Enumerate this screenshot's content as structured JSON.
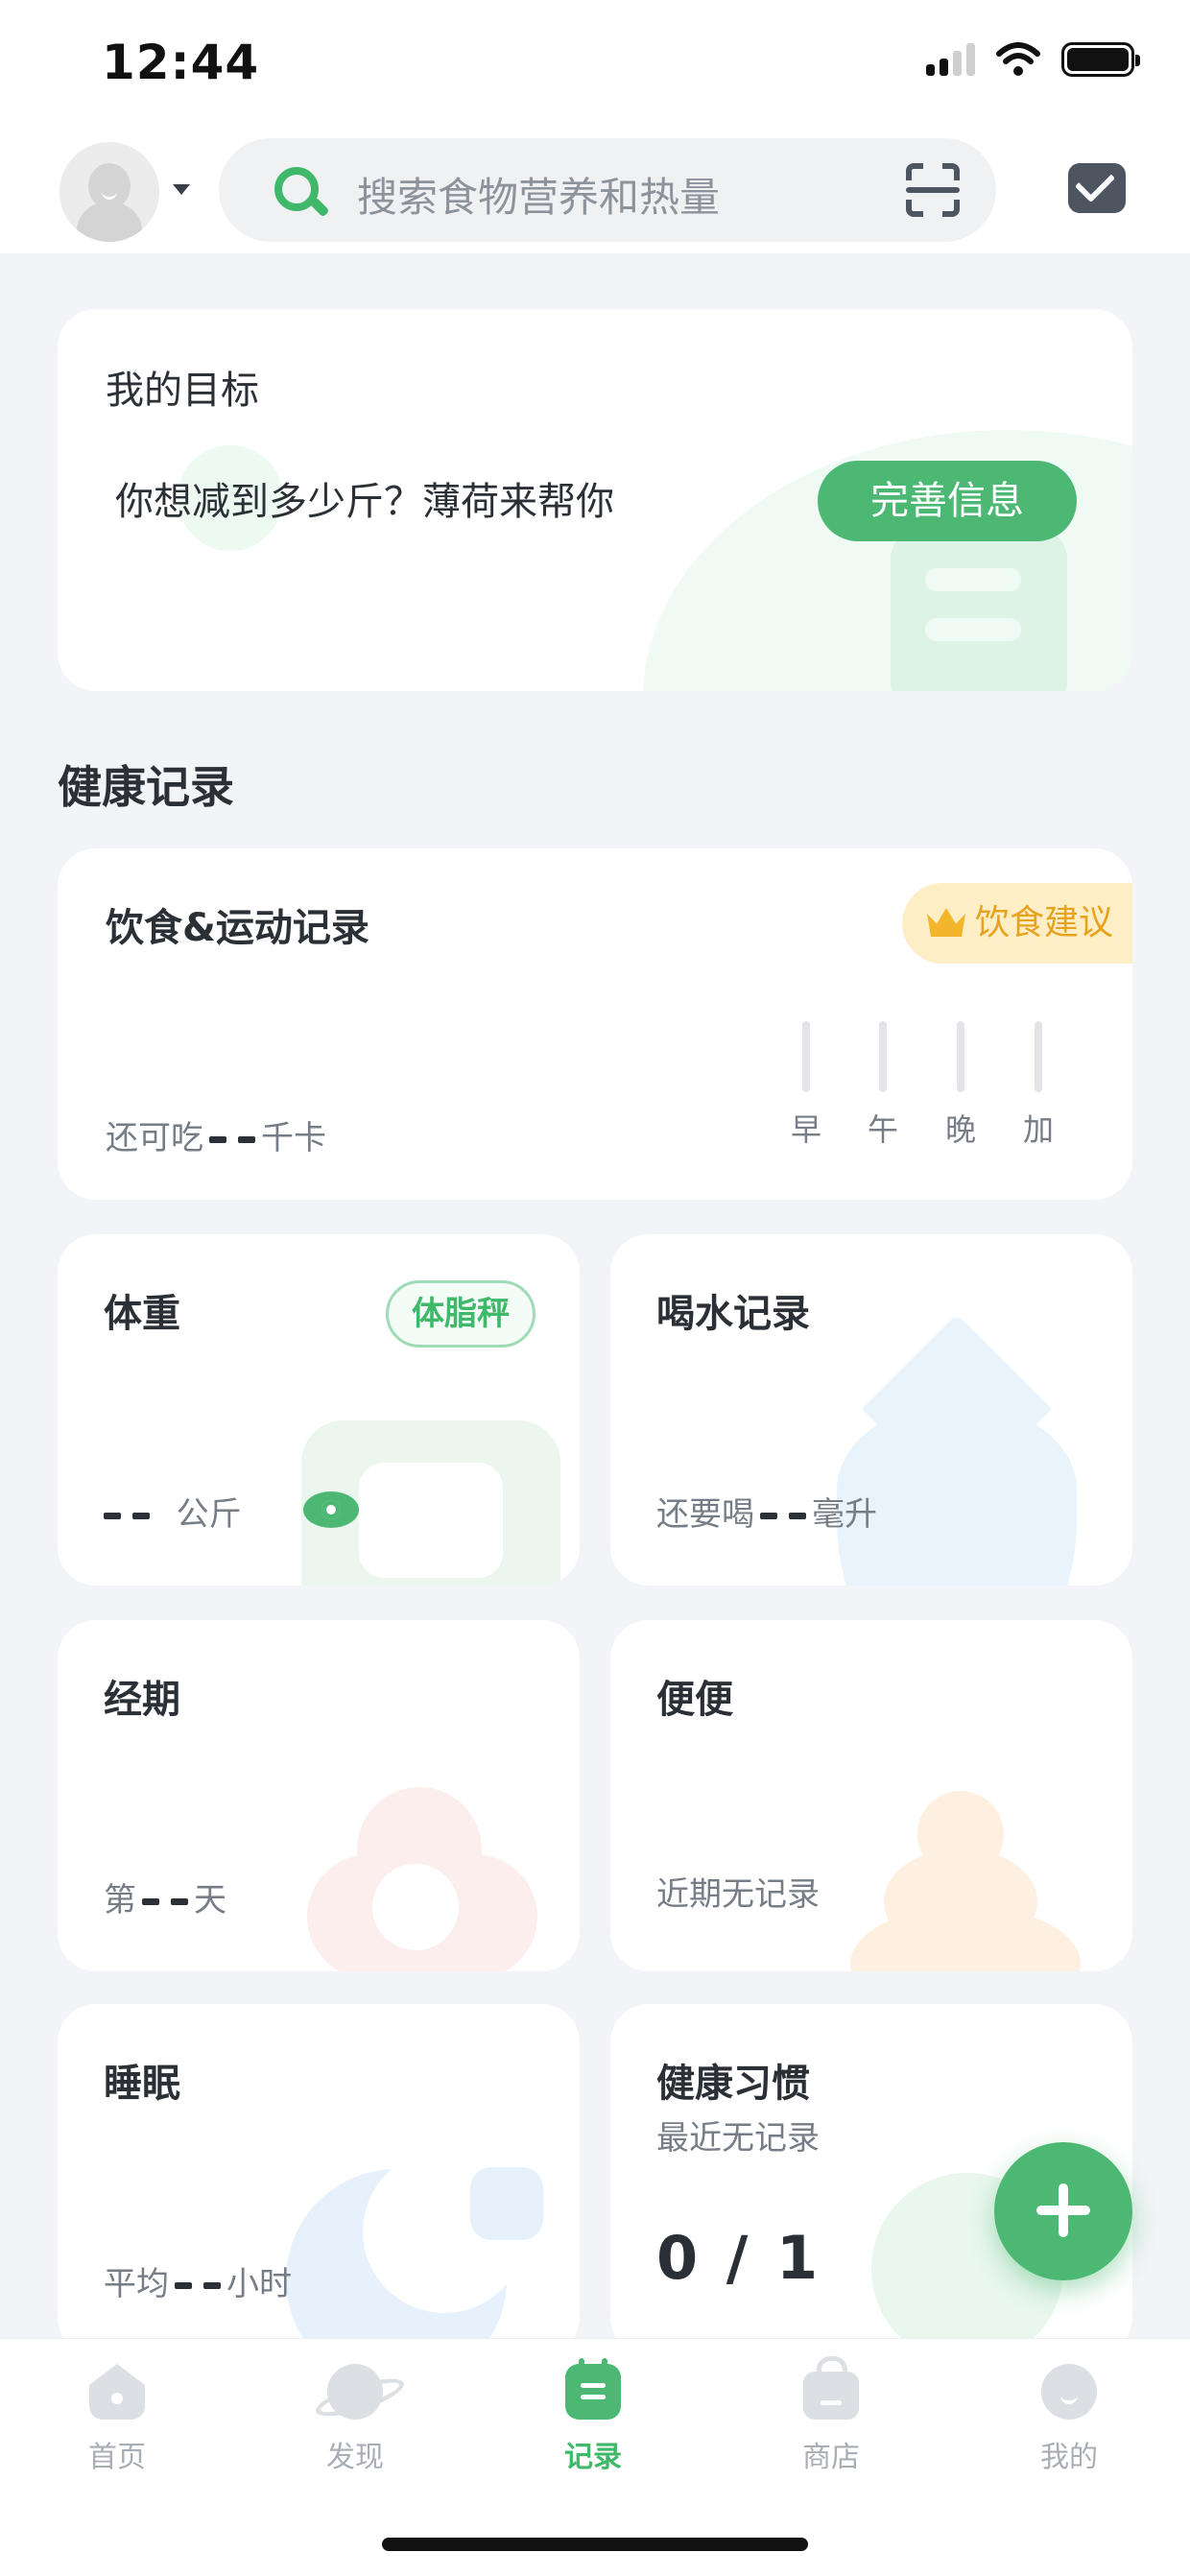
{
  "status_bar": {
    "time": "12:44"
  },
  "header": {
    "search_placeholder": "搜索食物营养和热量"
  },
  "goal": {
    "title": "我的目标",
    "prompt": "你想减到多少斤？薄荷来帮你",
    "button": "完善信息"
  },
  "section_title": "健康记录",
  "diet": {
    "title": "饮食&运动记录",
    "badge": "饮食建议",
    "remain_prefix": "还可吃",
    "remain_unit": "千卡",
    "meals": [
      "早",
      "午",
      "晚",
      "加"
    ]
  },
  "weight": {
    "title": "体重",
    "badge": "体脂秤",
    "unit": "公斤"
  },
  "water": {
    "title": "喝水记录",
    "prefix": "还要喝",
    "unit": "毫升"
  },
  "period": {
    "title": "经期",
    "prefix": "第",
    "unit": "天"
  },
  "stool": {
    "title": "便便",
    "status": "近期无记录"
  },
  "sleep": {
    "title": "睡眠",
    "prefix": "平均",
    "unit": "小时"
  },
  "habit": {
    "title": "健康习惯",
    "status": "最近无记录",
    "count": "0 / 1"
  },
  "tabs": [
    {
      "label": "首页",
      "icon": "home-icon"
    },
    {
      "label": "发现",
      "icon": "planet-icon"
    },
    {
      "label": "记录",
      "icon": "record-icon",
      "active": true
    },
    {
      "label": "商店",
      "icon": "shop-icon"
    },
    {
      "label": "我的",
      "icon": "me-icon"
    }
  ],
  "colors": {
    "accent": "#4cb874",
    "badge_gold": "#e7a21e",
    "background": "#f2f4f7"
  }
}
